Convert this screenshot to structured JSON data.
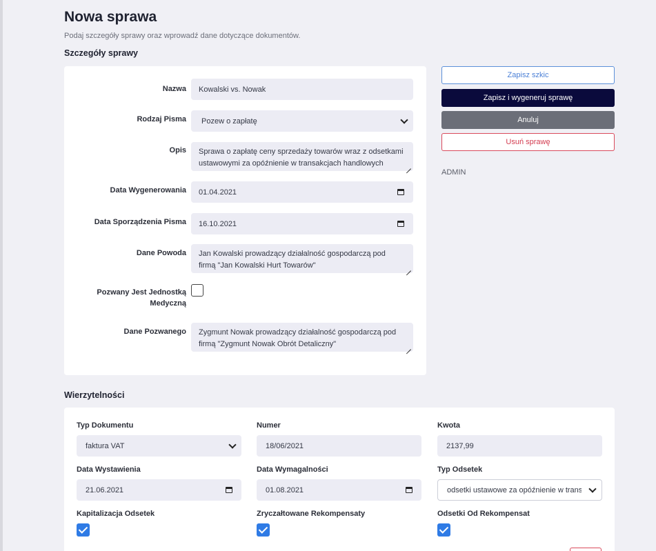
{
  "page": {
    "title": "Nowa sprawa",
    "subtitle": "Podaj szczegóły sprawy oraz wprowadź dane dotyczące dokumentów."
  },
  "details": {
    "section_title": "Szczegóły sprawy",
    "fields": {
      "name": {
        "label": "Nazwa",
        "value": "Kowalski vs. Nowak"
      },
      "type": {
        "label": "Rodzaj Pisma",
        "value": "Pozew o zapłatę"
      },
      "description": {
        "label": "Opis",
        "value": "Sprawa o zapłatę ceny sprzedaży towarów wraz z odsetkami ustawowymi za opóźnienie w transakcjach handlowych"
      },
      "generated_date": {
        "label": "Data Wygenerowania",
        "value": "01.04.2021"
      },
      "drafted_date": {
        "label": "Data Sporządzenia Pisma",
        "value": "16.10.2021"
      },
      "plaintiff": {
        "label": "Dane Powoda",
        "value": "Jan Kowalski prowadzący działalność gospodarczą pod firmą \"Jan Kowalski Hurt Towarów\""
      },
      "medical_unit": {
        "label": "Pozwany Jest Jednostką Medyczną",
        "checked": false
      },
      "defendant": {
        "label": "Dane Pozwanego",
        "value": "Zygmunt Nowak prowadzący działalność gospodarczą pod firmą \"Zygmunt Nowak Obrót Detaliczny\""
      }
    }
  },
  "actions": {
    "save_draft": "Zapisz szkic",
    "save_generate": "Zapisz i wygeneruj sprawę",
    "cancel": "Anuluj",
    "delete": "Usuń sprawę",
    "role": "ADMIN"
  },
  "claims": {
    "section_title": "Wierzytelności",
    "doc_type": {
      "label": "Typ Dokumentu",
      "value": "faktura VAT"
    },
    "number": {
      "label": "Numer",
      "value": "18/06/2021"
    },
    "amount": {
      "label": "Kwota",
      "value": "2137,99"
    },
    "issue_date": {
      "label": "Data Wystawienia",
      "value": "21.06.2021"
    },
    "due_date": {
      "label": "Data Wymagalności",
      "value": "01.08.2021"
    },
    "interest_type": {
      "label": "Typ Odsetek",
      "value": "odsetki ustawowe za opóźnienie w transakcjach handlowych"
    },
    "capitalization": {
      "label": "Kapitalizacja Odsetek",
      "checked": true
    },
    "flat_compensation": {
      "label": "Zryczałtowane Rekompensaty",
      "checked": true
    },
    "compensation_interest": {
      "label": "Odsetki Od Rekompensat",
      "checked": true
    }
  },
  "colors": {
    "primary_dark": "#0a0a3c",
    "secondary": "#6b6e78",
    "outline_blue": "#4a7fd6",
    "danger": "#d33b4f",
    "checkbox_blue": "#2f7be5"
  }
}
